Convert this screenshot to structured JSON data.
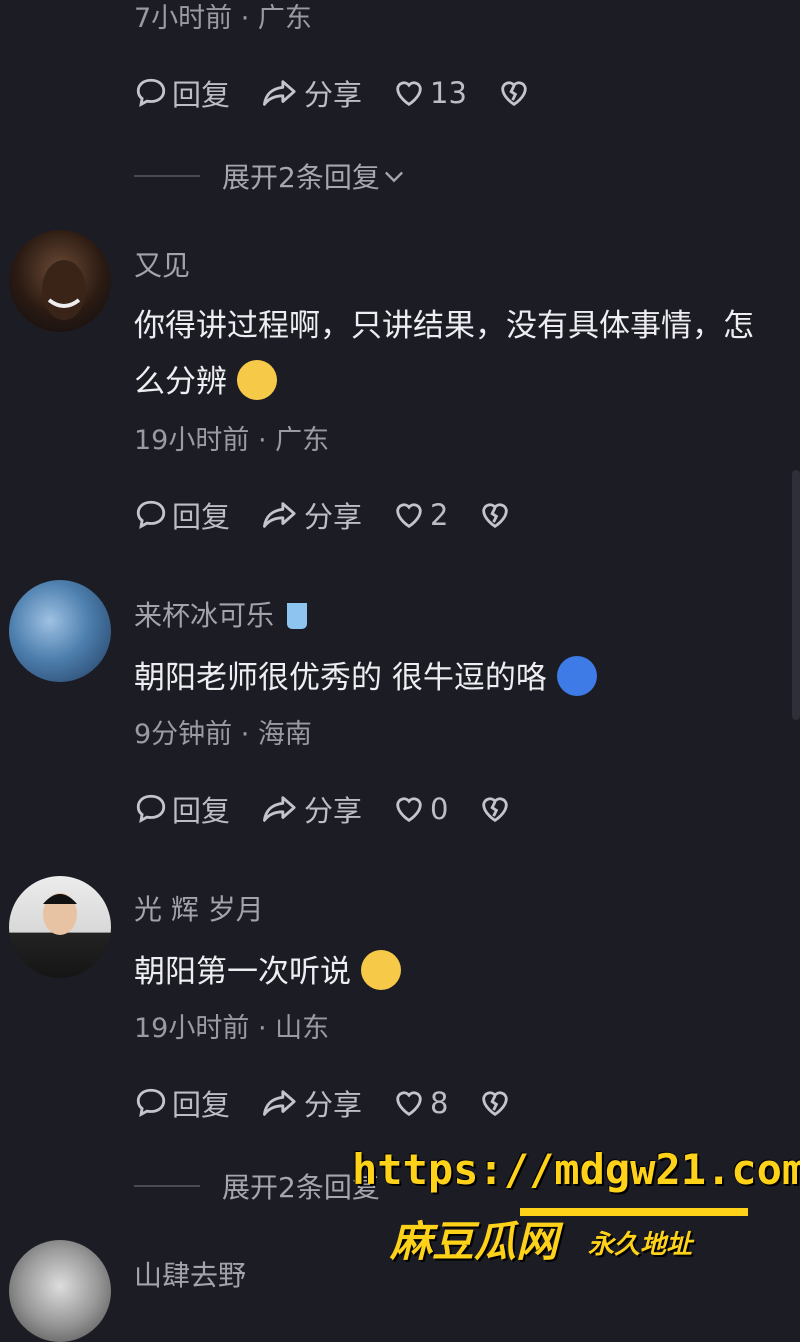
{
  "top": {
    "meta": "7小时前 · 广东",
    "actions": {
      "reply": "回复",
      "share": "分享",
      "likes": "13"
    },
    "expand": "展开2条回复"
  },
  "comments": [
    {
      "name": "又见",
      "text": "你得讲过程啊，只讲结果，没有具体事情，怎么分辨",
      "emoji": "shushing-face",
      "meta": "19小时前 · 广东",
      "reply": "回复",
      "share": "分享",
      "likes": "2"
    },
    {
      "name": "来杯冰可乐",
      "name_emoji": "cup-icon",
      "text": "朝阳老师很优秀的 很牛逗的咯",
      "emoji": "cold-face",
      "meta": "9分钟前 · 海南",
      "reply": "回复",
      "share": "分享",
      "likes": "0"
    },
    {
      "name": "光 辉 岁月",
      "text": "朝阳第一次听说",
      "emoji": "laughing-crying-face",
      "meta": "19小时前 · 山东",
      "reply": "回复",
      "share": "分享",
      "likes": "8",
      "expand": "展开2条回复"
    },
    {
      "name": "山肆去野"
    }
  ],
  "watermark": {
    "url": "https://mdgw21.com",
    "brand": "麻豆瓜网",
    "sub": "永久地址"
  },
  "colors": {
    "background": "#1c1c24",
    "accent": "#ffd21a"
  }
}
